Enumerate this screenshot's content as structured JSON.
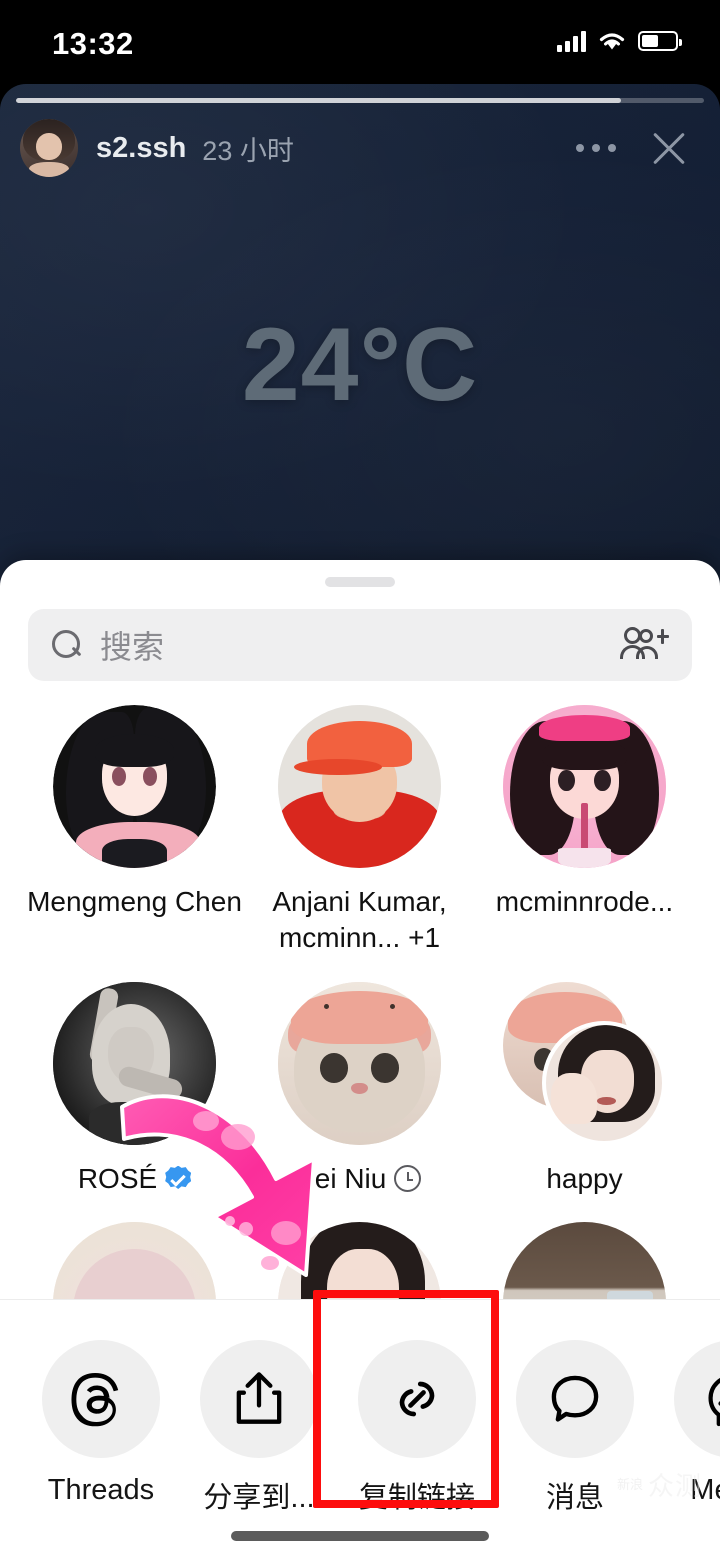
{
  "status_bar": {
    "time": "13:32",
    "signal_icon": "cellular-bars-icon",
    "wifi_icon": "wifi-icon",
    "battery_icon": "battery-icon",
    "battery_level_pct": 45
  },
  "story": {
    "progress_pct": 88,
    "username": "s2.ssh",
    "timestamp": "23 小时",
    "more_icon": "ellipsis-icon",
    "close_icon": "close-icon",
    "avatar_icon": "story-author-avatar",
    "overlay_text": "24°C",
    "background_color": "#17243a"
  },
  "share_sheet": {
    "grabber": "drag-handle",
    "search": {
      "placeholder": "搜索",
      "value": "",
      "search_icon": "search-icon",
      "add_people_icon": "add-people-icon"
    },
    "contacts": [
      [
        {
          "name": "Mengmeng Chen",
          "avatar": "anime-girl-black-hair-avatar",
          "badge": "none"
        },
        {
          "name": "Anjani Kumar, mcminn... +1",
          "avatar": "man-orange-cap-avatar",
          "badge": "none"
        },
        {
          "name": "mcminnrode...",
          "avatar": "anime-girl-pink-headband-avatar",
          "badge": "none"
        }
      ],
      [
        {
          "name": "ROSÉ",
          "avatar": "rose-bw-photo-avatar",
          "badge": "verified"
        },
        {
          "name": "Fei Niu",
          "avatar": "cat-pink-hat-avatar",
          "badge": "clock"
        },
        {
          "name": "happy",
          "avatar": "group-avatar",
          "badge": "none"
        }
      ],
      [
        {
          "name": "",
          "avatar": "partial-avatar-1",
          "badge": "none"
        },
        {
          "name": "",
          "avatar": "partial-avatar-2",
          "badge": "none"
        },
        {
          "name": "",
          "avatar": "partial-avatar-3",
          "badge": "none"
        }
      ]
    ]
  },
  "share_actions": [
    {
      "label": "Threads",
      "icon": "threads-icon",
      "highlighted": false
    },
    {
      "label": "分享到...",
      "icon": "share-up-arrow-icon",
      "highlighted": false
    },
    {
      "label": "复制链接",
      "icon": "link-icon",
      "highlighted": true
    },
    {
      "label": "消息",
      "icon": "chat-bubble-icon",
      "highlighted": false
    },
    {
      "label": "Messe",
      "icon": "messenger-icon",
      "highlighted": false
    }
  ],
  "annotations": {
    "arrow": {
      "shape": "curved-glitter-arrow",
      "color": "#fb3ba0",
      "points_to": "复制链接"
    },
    "highlight_box": {
      "color": "#fd0d0d",
      "target": "复制链接"
    }
  },
  "watermark": {
    "small": "新浪",
    "big": "众测"
  },
  "home_indicator": "home-indicator"
}
